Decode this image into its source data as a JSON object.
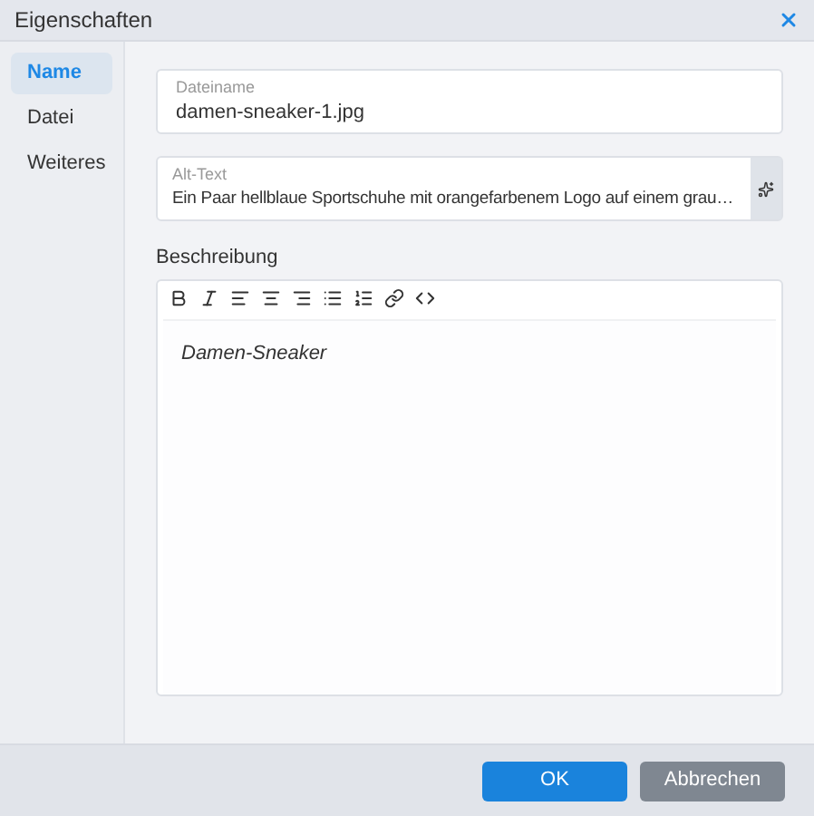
{
  "window": {
    "title": "Eigenschaften"
  },
  "sidebar": {
    "items": [
      {
        "label": "Name",
        "selected": true
      },
      {
        "label": "Datei",
        "selected": false
      },
      {
        "label": "Weiteres",
        "selected": false
      }
    ]
  },
  "fields": [
    {
      "label": "Dateiname",
      "value": "damen-sneaker-1.jpg",
      "kind": "plain"
    },
    {
      "label": "Alt-Text",
      "value": "Ein Paar hellblaue Sportschuhe mit orangefarbenem Logo auf einem grau…",
      "kind": "ai"
    }
  ],
  "description": {
    "label": "Beschreibung",
    "text": "Damen-Sneaker"
  },
  "buttons": [
    {
      "label": "OK",
      "kind": "primary"
    },
    {
      "label": "Abbrechen",
      "kind": "secondary"
    }
  ]
}
